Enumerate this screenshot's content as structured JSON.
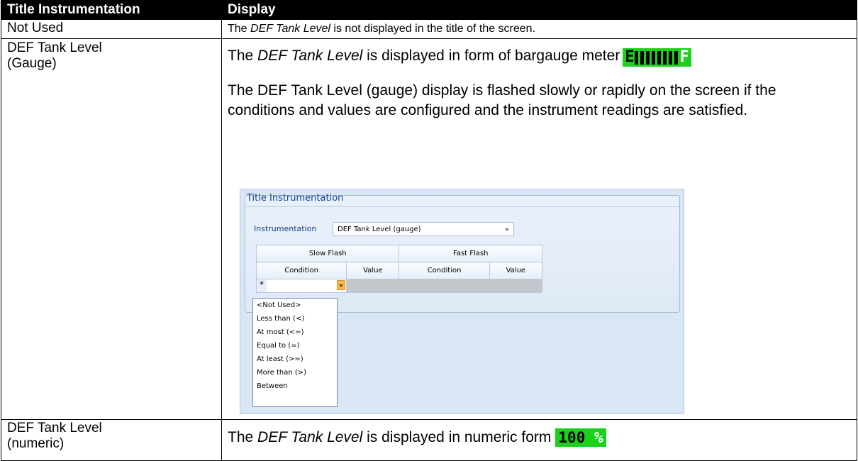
{
  "table": {
    "headers": [
      "Title Instrumentation",
      "Display"
    ],
    "row1": {
      "left": "Not Used",
      "right_pre": "The ",
      "right_em": "DEF Tank Level",
      "right_post": " is not displayed in the title of the screen."
    },
    "row2": {
      "left_line1": "DEF Tank Level",
      "left_line2": "(Gauge)",
      "p1_pre": "The ",
      "p1_em": "DEF Tank Level",
      "p1_post": " is displayed in form of bargauge meter",
      "gauge": {
        "left_letter": "E",
        "right_letter": "F",
        "level": 1.0,
        "color": "#1bd11b"
      },
      "p2": "The DEF Tank Level (gauge) display is flashed slowly or rapidly on the screen if the conditions and values are configured and the instrument readings are satisfied."
    },
    "row3": {
      "left_line1": "DEF Tank Level",
      "left_line2": "(numeric)",
      "pre": "The ",
      "em": "DEF Tank Level",
      "post": " is displayed in numeric form",
      "value": "100",
      "unit": "%"
    }
  },
  "screenshot": {
    "group_title": "Title Instrumentation",
    "instr_label": "Instrumentation",
    "instr_value": "DEF Tank Level (gauge)",
    "grid": {
      "slow_flash": "Slow Flash",
      "fast_flash": "Fast Flash",
      "condition": "Condition",
      "value": "Value",
      "new_row_marker": "*"
    },
    "dropdown_items": [
      "<Not Used>",
      "Less than (<)",
      "At most (<=)",
      "Equal to (=)",
      "At least (>=)",
      "More than (>)",
      "Between"
    ]
  }
}
